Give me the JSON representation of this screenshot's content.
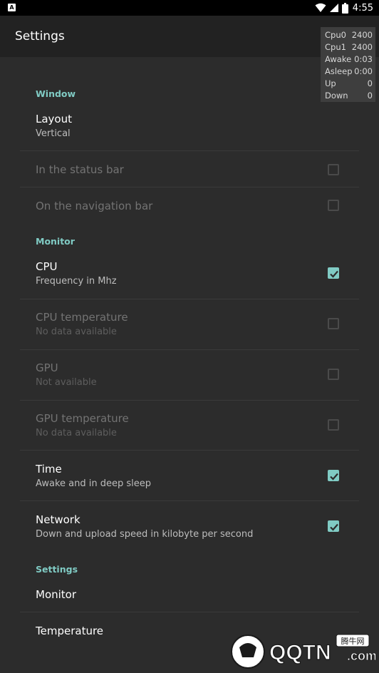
{
  "status_bar": {
    "app_icon_letter": "A",
    "time": "4:55",
    "icons": [
      "wifi-icon",
      "signal-icon",
      "battery-icon"
    ]
  },
  "app_bar": {
    "title": "Settings"
  },
  "overlay": {
    "rows": [
      {
        "label": "Cpu0",
        "value": "2400"
      },
      {
        "label": "Cpu1",
        "value": "2400"
      },
      {
        "label": "Awake",
        "value": "0:03"
      },
      {
        "label": "Asleep",
        "value": "0:00"
      },
      {
        "label": "Up",
        "value": "0"
      },
      {
        "label": "Down",
        "value": "0"
      }
    ]
  },
  "sections": {
    "window": "Window",
    "monitor": "Monitor",
    "settings": "Settings"
  },
  "items": {
    "layout": {
      "title": "Layout",
      "subtitle": "Vertical"
    },
    "status_bar": {
      "title": "In the status bar",
      "checked": false,
      "enabled": false
    },
    "navigation_bar": {
      "title": "On the navigation bar",
      "checked": false,
      "enabled": false
    },
    "cpu": {
      "title": "CPU",
      "subtitle": "Frequency in Mhz",
      "checked": true,
      "enabled": true
    },
    "cpu_temperature": {
      "title": "CPU temperature",
      "subtitle": "No data available",
      "checked": false,
      "enabled": false
    },
    "gpu": {
      "title": "GPU",
      "subtitle": "Not available",
      "checked": false,
      "enabled": false
    },
    "gpu_temperature": {
      "title": "GPU temperature",
      "subtitle": "No data available",
      "checked": false,
      "enabled": false
    },
    "time": {
      "title": "Time",
      "subtitle": "Awake and in deep sleep",
      "checked": true,
      "enabled": true
    },
    "network": {
      "title": "Network",
      "subtitle": "Down and upload speed in kilobyte per second",
      "checked": true,
      "enabled": true
    },
    "monitor": {
      "title": "Monitor"
    },
    "temperature": {
      "title": "Temperature"
    }
  },
  "watermark": {
    "brand": "QQTN",
    "domain": ".com",
    "chinese": "腾牛网"
  },
  "colors": {
    "accent": "#80cbc4",
    "background": "#2c2c2c",
    "app_bar": "#222222"
  }
}
